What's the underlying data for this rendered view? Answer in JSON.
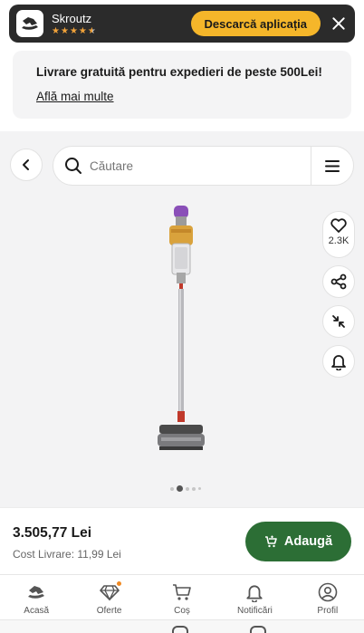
{
  "app_banner": {
    "app_name": "Skroutz",
    "rating_stars": 4.5,
    "download_label": "Descarcă aplicația",
    "close_icon": "close-icon",
    "logo_icon": "skroutz-logo-icon"
  },
  "shipping_promo": {
    "title": "Livrare gratuită pentru expedieri de peste 500Lei!",
    "link": "Află mai multe"
  },
  "search": {
    "placeholder": "Căutare",
    "icon": "search-icon",
    "menu_icon": "hamburger-menu-icon",
    "back_icon": "chevron-left-icon"
  },
  "product": {
    "image": "cordless-vacuum-cleaner",
    "favorites_count": "2.3K",
    "actions": [
      "heart-icon",
      "share-icon",
      "collapse-icon",
      "bell-icon"
    ],
    "gallery_active_index": 1,
    "gallery_count": 5
  },
  "purchase": {
    "price": "3.505,77 Lei",
    "shipping_cost": "Cost Livrare: 11,99 Lei",
    "add_label": "Adaugă",
    "add_icon": "cart-plus-icon"
  },
  "bottom_nav": {
    "items": [
      {
        "label": "Acasă",
        "icon": "home-hat-icon"
      },
      {
        "label": "Oferte",
        "icon": "diamond-icon",
        "badge": true
      },
      {
        "label": "Coș",
        "icon": "cart-icon"
      },
      {
        "label": "Notificări",
        "icon": "bell-icon"
      },
      {
        "label": "Profil",
        "icon": "profile-icon"
      }
    ]
  },
  "colors": {
    "banner_bg": "#2b2b2b",
    "download_button": "#f5b62a",
    "add_button": "#2c6e35",
    "star": "#f0a23a",
    "badge": "#f08a24"
  }
}
